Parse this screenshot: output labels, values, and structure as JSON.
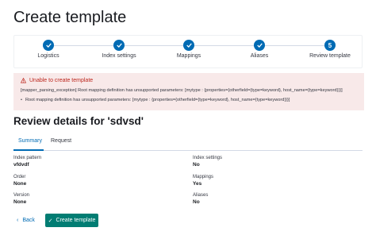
{
  "page": {
    "title": "Create template"
  },
  "steps": [
    {
      "number": "",
      "label": "Logistics",
      "status": "complete"
    },
    {
      "number": "",
      "label": "Index settings",
      "status": "complete"
    },
    {
      "number": "",
      "label": "Mappings",
      "status": "complete"
    },
    {
      "number": "",
      "label": "Aliases",
      "status": "complete"
    },
    {
      "number": "5",
      "label": "Review template",
      "status": "current"
    }
  ],
  "error": {
    "title": "Unable to create template",
    "body": "[mapper_parsing_exception] Root mapping definition has unsupported parameters: [mytype : {properties={otherfield={type=keyword}, host_name={type=keyword}}}]",
    "bullet": "Root mapping definition has unsupported parameters: [mytype : {properties={otherfield={type=keyword}, host_name={type=keyword}}}]"
  },
  "review": {
    "title": "Review details for 'sdvsd'"
  },
  "tabs": [
    {
      "label": "Summary",
      "active": true
    },
    {
      "label": "Request",
      "active": false
    }
  ],
  "summary": {
    "left": [
      {
        "title": "Index pattern",
        "value": "vfdvdf"
      },
      {
        "title": "Order",
        "value": "None"
      },
      {
        "title": "Version",
        "value": "None"
      }
    ],
    "right": [
      {
        "title": "Index settings",
        "value": "No"
      },
      {
        "title": "Mappings",
        "value": "Yes"
      },
      {
        "title": "Aliases",
        "value": "No"
      }
    ]
  },
  "actions": {
    "back_label": "Back",
    "create_label": "Create template"
  },
  "colors": {
    "primary": "#006bb4",
    "danger": "#bd271e",
    "success": "#017d73",
    "callout_bg": "#f8e9e9"
  }
}
